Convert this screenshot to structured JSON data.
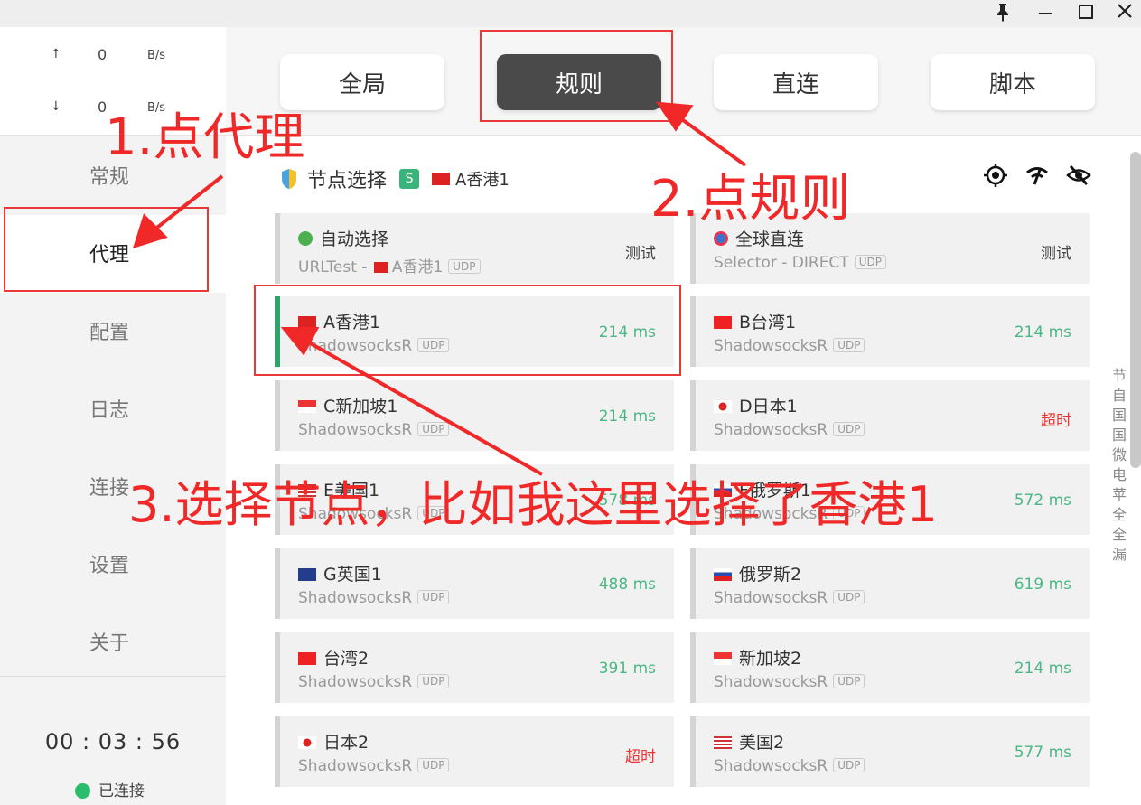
{
  "window": {
    "pin_icon": "pin-icon",
    "min_icon": "minimize-icon",
    "max_icon": "maximize-icon",
    "close_icon": "close-icon"
  },
  "traffic": {
    "up_arrow": "↑",
    "up_value": "0",
    "up_unit": "B/s",
    "down_arrow": "↓",
    "down_value": "0",
    "down_unit": "B/s"
  },
  "nav": {
    "items": [
      {
        "label": "常规"
      },
      {
        "label": "代理"
      },
      {
        "label": "配置"
      },
      {
        "label": "日志"
      },
      {
        "label": "连接"
      },
      {
        "label": "设置"
      },
      {
        "label": "关于"
      }
    ],
    "active": "代理"
  },
  "footer": {
    "timer": "00 : 03 : 56",
    "status": "已连接",
    "status_color": "#2bbd6e"
  },
  "modes": {
    "items": [
      {
        "label": "全局"
      },
      {
        "label": "规则"
      },
      {
        "label": "直连"
      },
      {
        "label": "脚本"
      }
    ],
    "active": "规则"
  },
  "group": {
    "title": "节点选择",
    "badge": "S",
    "selected": "A香港1"
  },
  "proxies": [
    {
      "name": "自动选择",
      "type": "URLTest - ",
      "type_suffix": "A香港1",
      "value": "测试",
      "status": "test",
      "icon": "recycle-icon"
    },
    {
      "name": "全球直连",
      "type": "Selector - DIRECT",
      "type_suffix": "",
      "value": "测试",
      "status": "test",
      "icon": "globe-icon"
    },
    {
      "name": "A香港1",
      "type": "ShadowsocksR",
      "type_suffix": "",
      "value": "214 ms",
      "status": "ok",
      "icon": "hk-flag-icon"
    },
    {
      "name": "B台湾1",
      "type": "ShadowsocksR",
      "type_suffix": "",
      "value": "214 ms",
      "status": "ok",
      "icon": "cn-flag-icon"
    },
    {
      "name": "C新加坡1",
      "type": "ShadowsocksR",
      "type_suffix": "",
      "value": "214 ms",
      "status": "ok",
      "icon": "sg-flag-icon"
    },
    {
      "name": "D日本1",
      "type": "ShadowsocksR",
      "type_suffix": "",
      "value": "超时",
      "status": "timeout",
      "icon": "jp-flag-icon"
    },
    {
      "name": "E美国1",
      "type": "ShadowsocksR",
      "type_suffix": "",
      "value": "578 ms",
      "status": "ok",
      "icon": "us-flag-icon"
    },
    {
      "name": "F俄罗斯1",
      "type": "ShadowsocksR",
      "type_suffix": "",
      "value": "572 ms",
      "status": "ok",
      "icon": "ru-flag-icon"
    },
    {
      "name": "G英国1",
      "type": "ShadowsocksR",
      "type_suffix": "",
      "value": "488 ms",
      "status": "ok",
      "icon": "uk-flag-icon"
    },
    {
      "name": "俄罗斯2",
      "type": "ShadowsocksR",
      "type_suffix": "",
      "value": "619 ms",
      "status": "ok",
      "icon": "ru-flag-icon"
    },
    {
      "name": "台湾2",
      "type": "ShadowsocksR",
      "type_suffix": "",
      "value": "391 ms",
      "status": "ok",
      "icon": "cn-flag-icon"
    },
    {
      "name": "新加坡2",
      "type": "ShadowsocksR",
      "type_suffix": "",
      "value": "214 ms",
      "status": "ok",
      "icon": "sg-flag-icon"
    },
    {
      "name": "日本2",
      "type": "ShadowsocksR",
      "type_suffix": "",
      "value": "超时",
      "status": "timeout",
      "icon": "jp-flag-icon"
    },
    {
      "name": "美国2",
      "type": "ShadowsocksR",
      "type_suffix": "",
      "value": "577 ms",
      "status": "ok",
      "icon": "us-flag-icon"
    }
  ],
  "udp_label": "UDP",
  "side_text": [
    "节",
    "自",
    "国",
    "国",
    "微",
    "电",
    "苹",
    "全",
    "全",
    "漏"
  ],
  "annotations": {
    "step1": "1.点代理",
    "step2": "2.点规则",
    "step3": "3.选择节点，比如我这里选择了香港1",
    "color": "#f02828"
  },
  "colors": {
    "accent_green": "#2ba56a",
    "latency_ok": "#4bb884",
    "latency_timeout": "#e33333",
    "mode_active_bg": "#4a4a4a"
  }
}
